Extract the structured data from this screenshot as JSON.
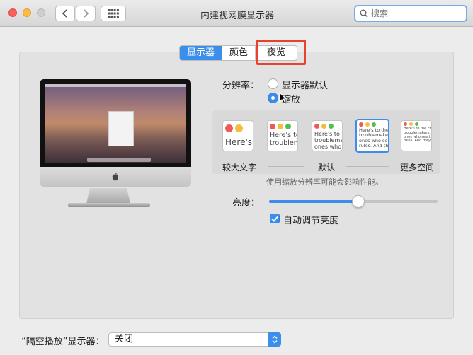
{
  "window": {
    "title": "内建视网膜显示器"
  },
  "search": {
    "placeholder": "搜索"
  },
  "tabs": [
    {
      "label": "显示器",
      "active": true
    },
    {
      "label": "颜色",
      "active": false
    },
    {
      "label": "夜览",
      "active": false
    }
  ],
  "resolution": {
    "label": "分辨率：",
    "options": [
      {
        "label": "显示器默认",
        "selected": false
      },
      {
        "label": "缩放",
        "selected": true
      }
    ]
  },
  "scaling": {
    "thumbs": [
      {
        "text": "Here's",
        "selected": false
      },
      {
        "text": "Here's to troublem",
        "selected": false
      },
      {
        "text": "Here's to t troublemak ones who",
        "selected": false
      },
      {
        "text": "Here's to the c troublemakers. ones who see t rules. And they",
        "selected": true
      },
      {
        "text": "Here's to the crazy troublemakers. the ones who see things rules. And they have",
        "selected": false
      }
    ],
    "left_label": "较大文字",
    "mid_label": "默认",
    "right_label": "更多空间",
    "note": "使用缩放分辨率可能会影响性能。"
  },
  "brightness": {
    "label": "亮度：",
    "level_fraction": 0.53,
    "auto_label": "自动调节亮度",
    "auto_checked": true
  },
  "airplay": {
    "label": "“隔空播放”显示器：",
    "value": "关闭"
  },
  "colors": {
    "accent": "#3b8fea",
    "highlight": "#e8412f"
  }
}
